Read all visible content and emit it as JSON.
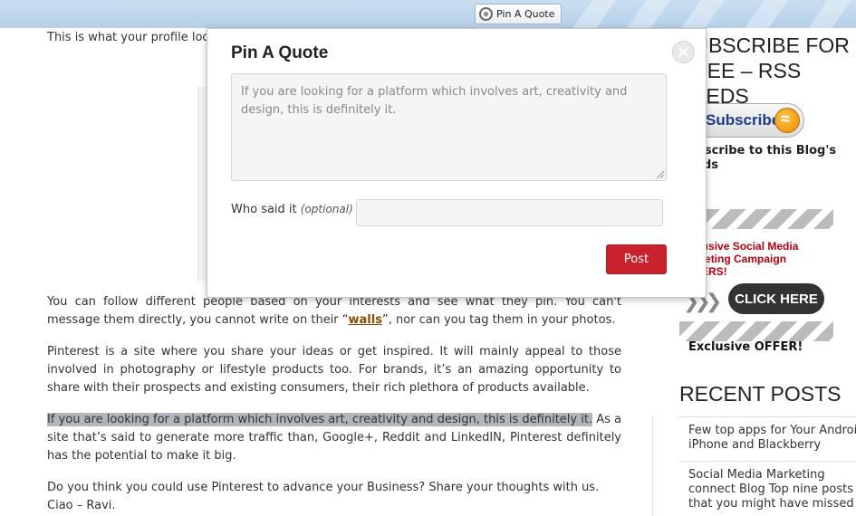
{
  "toolbar": {
    "pin_chip_label": "Pin A Quote",
    "pin_chip_icon": "globe-icon"
  },
  "article": {
    "intro_line1": "This is what your profile looks like at the moment.",
    "p1_pre": "You can follow different people based on your interests and see what they pin. You can't message them directly, you cannot write on their “",
    "p1_link": "walls",
    "p1_post": "”, nor can you tag them in your photos.",
    "p2": "Pinterest is a site where you share your ideas or get inspired. It will mainly appeal to those involved in photography or lifestyle products too. For brands, it’s an amazing opportunity to share with their prospects and existing consumers, their rich plethora of products available.",
    "p3_highlight": "If you are looking for a platform which involves art, creativity and design, this is definitely it.",
    "p3_rest": " As a site that’s said to generate more traffic than, Google+, Reddit and LinkedIN, Pinterest definitely has the potential to make it big.",
    "p4_line1": "Do you think you could use Pinterest to advance your Business? Share your thoughts with us.",
    "p4_line2": "Ciao – Ravi."
  },
  "sidebar": {
    "subscribe_title": "SUBSCRIBE FOR FREE – RSS FEEDS",
    "subscribe_button": "Subscribe",
    "subscribe_text": "Subscribe to this Blog's Feeds",
    "ad_text": "Exclusive Social Media Marketing Campaign OFFERS!",
    "ad_click": "CLICK HERE",
    "ad_caption": "Exclusive OFFER!",
    "recent_title": "RECENT POSTS",
    "recent_posts": [
      "Few top apps for Your Android, iPhone and Blackberry",
      "Social Media Marketing connect Blog Top nine posts that you might have missed"
    ]
  },
  "modal": {
    "title": "Pin A Quote",
    "close_label": "×",
    "quote_text": "If you are looking for a platform which involves art, creativity and design, this is definitely it.",
    "who_label": "Who said it",
    "who_optional": "(optional)",
    "who_value": "",
    "post_label": "Post"
  },
  "colors": {
    "accent_red": "#c8232c",
    "topbar_blue": "#b6d0e9",
    "highlight": "#b3b5bc"
  }
}
